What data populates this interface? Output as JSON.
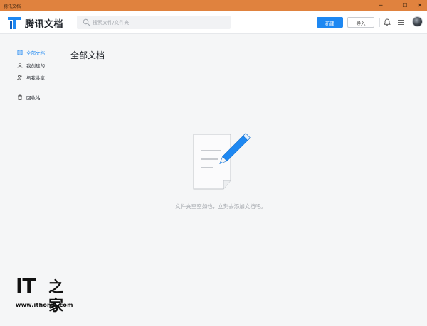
{
  "window": {
    "title": "腾讯文档",
    "controls": {
      "minimize": "─",
      "maximize": "☐",
      "close": "✕"
    }
  },
  "header": {
    "app_name": "腾讯文档",
    "logo_icon": "tencent-docs-logo",
    "search": {
      "placeholder": "搜索文件/文件夹",
      "value": ""
    },
    "new_button": "新建",
    "import_button": "导入",
    "icons": [
      "bell-icon",
      "menu-icon",
      "avatar"
    ],
    "accent_color": "#1e88f2"
  },
  "sidebar": {
    "items": [
      {
        "label": "全部文档",
        "icon": "docs-icon",
        "active": true
      },
      {
        "label": "我创建的",
        "icon": "user-icon",
        "active": false
      },
      {
        "label": "与我共享",
        "icon": "shared-users-icon",
        "active": false
      },
      {
        "label": "回收站",
        "icon": "trash-icon",
        "active": false
      }
    ]
  },
  "main": {
    "title": "全部文档",
    "empty_state": {
      "illustration": "document-pencil-icon",
      "message": "文件夹空空如也，立刻去添加文档吧。"
    }
  },
  "watermark": {
    "brand": "IT",
    "brand_cn": "之家",
    "url": "www.ithome.com"
  }
}
